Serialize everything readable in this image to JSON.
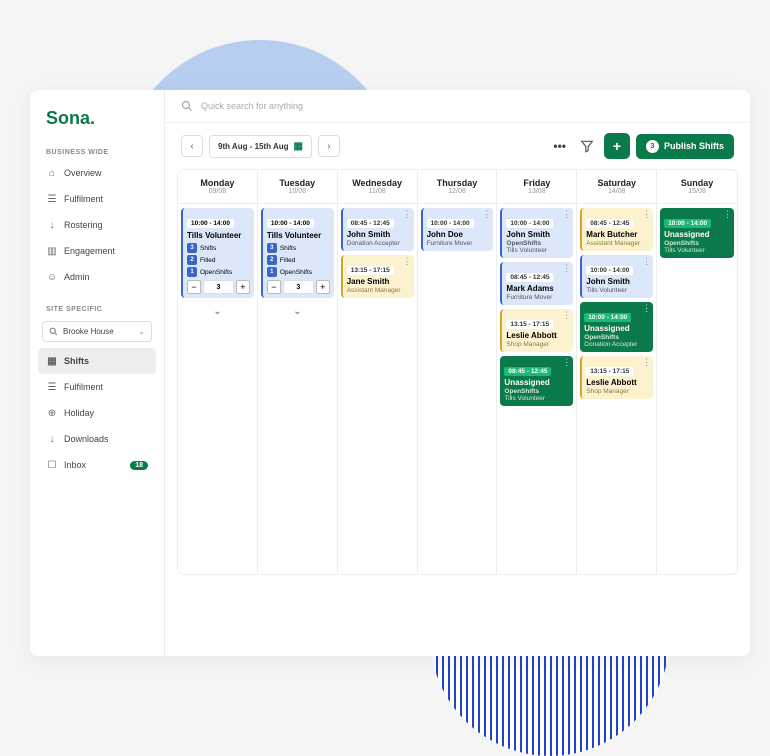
{
  "brand": "Sona.",
  "sidebar": {
    "section1_label": "BUSINESS WIDE",
    "section2_label": "SITE SPECIFIC",
    "site_name": "Brooke House",
    "items1": [
      {
        "label": "Overview"
      },
      {
        "label": "Fulfilment"
      },
      {
        "label": "Rostering"
      },
      {
        "label": "Engagement"
      },
      {
        "label": "Admin"
      }
    ],
    "items2": [
      {
        "label": "Shifts"
      },
      {
        "label": "Fulfilment"
      },
      {
        "label": "Holiday"
      },
      {
        "label": "Downloads"
      },
      {
        "label": "Inbox"
      }
    ],
    "inbox_count": "18"
  },
  "search": {
    "placeholder": "Quick search for anything"
  },
  "toolbar": {
    "date_range": "9th Aug - 15th Aug",
    "publish_label": "Publish Shifts",
    "publish_count": "3"
  },
  "days": [
    {
      "name": "Monday",
      "date": "09/08"
    },
    {
      "name": "Tuesday",
      "date": "10/08"
    },
    {
      "name": "Wednesday",
      "date": "11/08"
    },
    {
      "name": "Thursday",
      "date": "12/08"
    },
    {
      "name": "Friday",
      "date": "13/08"
    },
    {
      "name": "Saturday",
      "date": "14/08"
    },
    {
      "name": "Sunday",
      "date": "15/08"
    }
  ],
  "summary": {
    "mon": {
      "time": "10:00 - 14:00",
      "title": "Tills Volunteer",
      "stats": [
        {
          "n": "3",
          "label": "Shifts"
        },
        {
          "n": "2",
          "label": "Filled"
        },
        {
          "n": "1",
          "label": "OpenShifts"
        }
      ],
      "qty": "3"
    },
    "tue": {
      "time": "10:00 - 14:00",
      "title": "Tills Volunteer",
      "stats": [
        {
          "n": "3",
          "label": "Shifts"
        },
        {
          "n": "2",
          "label": "Filled"
        },
        {
          "n": "1",
          "label": "OpenShifts"
        }
      ],
      "qty": "3"
    }
  },
  "shifts": {
    "wed": [
      {
        "time": "08:45 - 12:45",
        "title": "John Smith",
        "sub": "Donation Accepter",
        "color": "blue"
      },
      {
        "time": "13:15 - 17:15",
        "title": "Jane Smith",
        "sub": "Assistant Manager",
        "color": "yellow"
      }
    ],
    "thu": [
      {
        "time": "10:00 - 14:00",
        "title": "John Doe",
        "sub": "Furniture Mover",
        "color": "blue"
      }
    ],
    "fri": [
      {
        "time": "10:00 - 14:00",
        "title": "John Smith",
        "sub2": "OpenShifts",
        "sub": "Tills Volunteer",
        "color": "blue"
      },
      {
        "time": "08:45 - 12:45",
        "title": "Mark Adams",
        "sub": "Furniture Mover",
        "color": "blue"
      },
      {
        "time": "13.15 - 17:15",
        "title": "Leslie Abbott",
        "sub": "Shop Manager",
        "color": "yellow"
      },
      {
        "time": "08:45 - 12:45",
        "title": "Unassigned",
        "sub2": "OpenShifts",
        "sub": "Tills Volunteer",
        "color": "green"
      }
    ],
    "sat": [
      {
        "time": "08:45 - 12:45",
        "title": "Mark Butcher",
        "sub": "Assistant Manager",
        "color": "yellow"
      },
      {
        "time": "10:00 - 14:00",
        "title": "John Smith",
        "sub": "Tills Volunteer",
        "color": "blue"
      },
      {
        "time": "10:00 - 14:00",
        "title": "Unassigned",
        "sub2": "OpenShifts",
        "sub": "Donation Accepter",
        "color": "green"
      },
      {
        "time": "13:15 - 17:15",
        "title": "Leslie Abbott",
        "sub": "Shop Manager",
        "color": "yellow"
      }
    ],
    "sun": [
      {
        "time": "10:00 - 14:00",
        "title": "Unassigned",
        "sub2": "OpenShifts",
        "sub": "Tills Volunteer",
        "color": "green"
      }
    ]
  }
}
